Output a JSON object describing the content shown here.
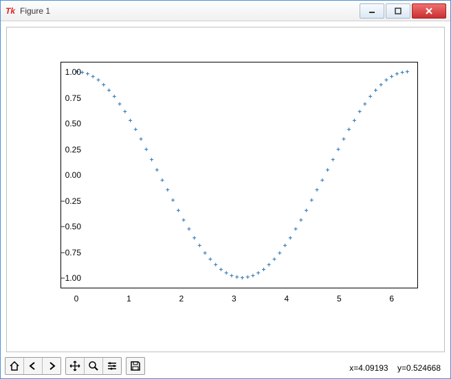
{
  "window": {
    "title": "Figure 1",
    "buttons": {
      "minimize": "Minimize",
      "maximize": "Maximize",
      "close": "Close"
    }
  },
  "chart_data": {
    "type": "scatter",
    "marker": "+",
    "color": "#3b7fb6",
    "title": "",
    "xlabel": "",
    "ylabel": "",
    "xlim": [
      -0.3,
      6.5
    ],
    "ylim": [
      -1.1,
      1.1
    ],
    "xticks": [
      0,
      1,
      2,
      3,
      4,
      5,
      6
    ],
    "yticks": [
      -1.0,
      -0.75,
      -0.5,
      -0.25,
      0.0,
      0.25,
      0.5,
      0.75,
      1.0
    ],
    "x": [
      0.0,
      0.101,
      0.203,
      0.304,
      0.406,
      0.507,
      0.609,
      0.71,
      0.812,
      0.913,
      1.015,
      1.116,
      1.217,
      1.319,
      1.42,
      1.522,
      1.623,
      1.725,
      1.826,
      1.928,
      2.029,
      2.131,
      2.232,
      2.333,
      2.435,
      2.536,
      2.638,
      2.739,
      2.841,
      2.942,
      3.044,
      3.145,
      3.247,
      3.348,
      3.449,
      3.551,
      3.652,
      3.754,
      3.855,
      3.957,
      4.058,
      4.16,
      4.261,
      4.362,
      4.464,
      4.565,
      4.667,
      4.768,
      4.87,
      4.971,
      5.073,
      5.174,
      5.276,
      5.377,
      5.478,
      5.58,
      5.681,
      5.783,
      5.884,
      5.986,
      6.087,
      6.189,
      6.283
    ],
    "y": [
      1.0,
      0.995,
      0.979,
      0.954,
      0.919,
      0.874,
      0.82,
      0.758,
      0.688,
      0.611,
      0.527,
      0.438,
      0.345,
      0.248,
      0.149,
      0.05,
      -0.05,
      -0.149,
      -0.248,
      -0.345,
      -0.438,
      -0.527,
      -0.611,
      -0.688,
      -0.758,
      -0.82,
      -0.874,
      -0.919,
      -0.954,
      -0.979,
      -0.995,
      -1.0,
      -0.995,
      -0.979,
      -0.954,
      -0.919,
      -0.874,
      -0.82,
      -0.758,
      -0.688,
      -0.611,
      -0.527,
      -0.438,
      -0.345,
      -0.248,
      -0.149,
      -0.05,
      0.05,
      0.149,
      0.248,
      0.345,
      0.438,
      0.527,
      0.611,
      0.688,
      0.758,
      0.82,
      0.874,
      0.919,
      0.954,
      0.979,
      0.995,
      1.0
    ]
  },
  "toolbar": {
    "home": "Home",
    "back": "Back",
    "forward": "Forward",
    "pan": "Pan",
    "zoom": "Zoom",
    "configure": "Configure subplots",
    "save": "Save"
  },
  "status": {
    "x_label": "x=4.09193",
    "y_label": "y=0.524668"
  }
}
